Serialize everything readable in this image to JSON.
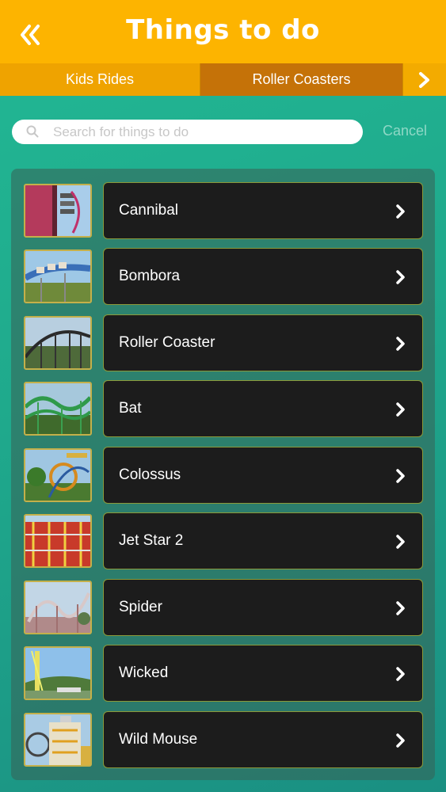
{
  "header": {
    "title": "Things to do",
    "back_icon": "double-chevron-left-icon"
  },
  "tabs": [
    {
      "label": "Kids Rides",
      "selected": false
    },
    {
      "label": "Roller Coasters",
      "selected": true
    }
  ],
  "tabs_next_icon": "chevron-right-icon",
  "search": {
    "placeholder": "Search for things to do",
    "value": "",
    "icon": "search-icon",
    "cancel_label": "Cancel"
  },
  "colors": {
    "header": "#fdb400",
    "tab_selected": "#c57208",
    "background": "#1fa98c",
    "item_card": "#1c1c1c",
    "item_border": "#8c9a3a"
  },
  "items": [
    {
      "label": "Cannibal",
      "icon": "chevron-right-icon"
    },
    {
      "label": "Bombora",
      "icon": "chevron-right-icon"
    },
    {
      "label": "Roller Coaster",
      "icon": "chevron-right-icon"
    },
    {
      "label": "Bat",
      "icon": "chevron-right-icon"
    },
    {
      "label": "Colossus",
      "icon": "chevron-right-icon"
    },
    {
      "label": "Jet Star 2",
      "icon": "chevron-right-icon"
    },
    {
      "label": "Spider",
      "icon": "chevron-right-icon"
    },
    {
      "label": "Wicked",
      "icon": "chevron-right-icon"
    },
    {
      "label": "Wild Mouse",
      "icon": "chevron-right-icon"
    }
  ]
}
